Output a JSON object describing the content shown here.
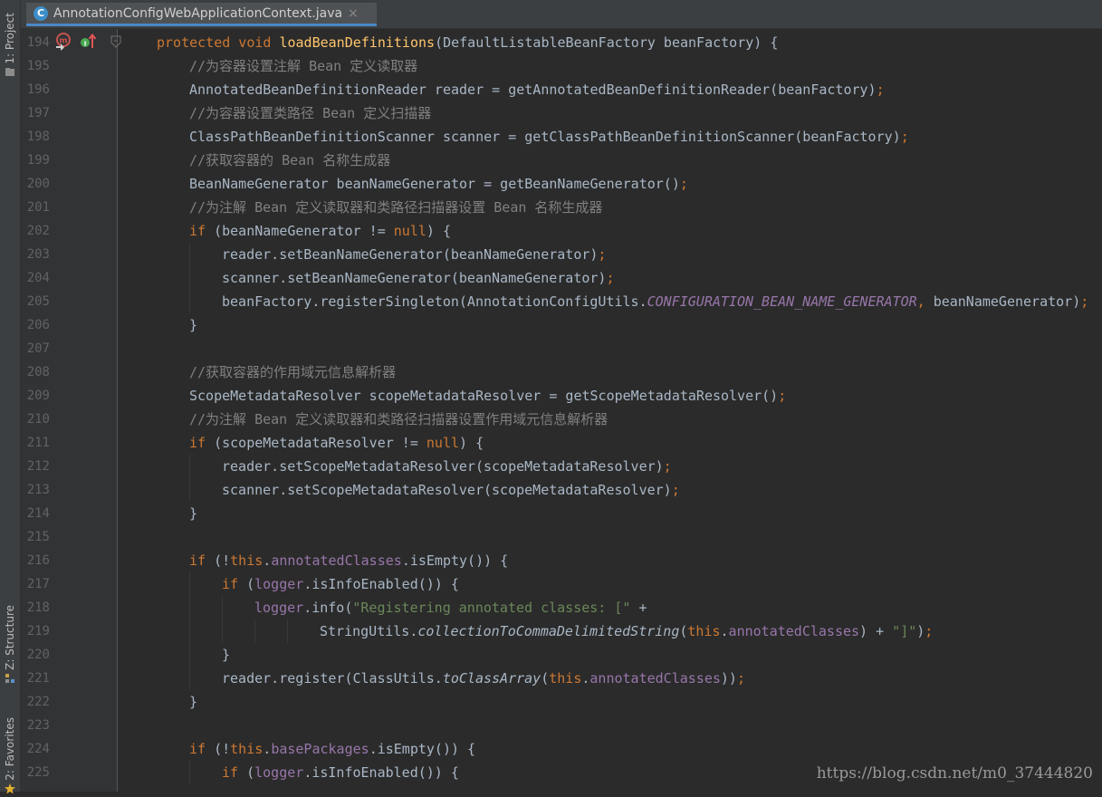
{
  "tab": {
    "icon_letter": "C",
    "filename": "AnnotationConfigWebApplicationContext.java",
    "close": "×"
  },
  "left_panels": [
    {
      "label": "1: Project",
      "icon": "project-icon"
    },
    {
      "label": "Z: Structure",
      "icon": "structure-icon"
    },
    {
      "label": "2: Favorites",
      "icon": "favorites-icon"
    }
  ],
  "gutter_markers": [
    "breakpoint-m-icon",
    "implements-override-icon",
    "fold-icon"
  ],
  "watermark": "https://blog.csdn.net/m0_37444820",
  "lines": [
    {
      "num": "194",
      "indent": 0,
      "tokens": [
        [
          "kw",
          "protected void "
        ],
        [
          "fn",
          "loadBeanDefinitions"
        ],
        [
          "txt",
          "(DefaultListableBeanFactory beanFactory) {"
        ]
      ]
    },
    {
      "num": "195",
      "indent": 1,
      "tokens": [
        [
          "cm",
          "//为容器设置注解 Bean 定义读取器"
        ]
      ]
    },
    {
      "num": "196",
      "indent": 1,
      "tokens": [
        [
          "txt",
          "AnnotatedBeanDefinitionReader reader = getAnnotatedBeanDefinitionReader(beanFactory)"
        ],
        [
          "kw",
          ";"
        ]
      ]
    },
    {
      "num": "197",
      "indent": 1,
      "tokens": [
        [
          "cm",
          "//为容器设置类路径 Bean 定义扫描器"
        ]
      ]
    },
    {
      "num": "198",
      "indent": 1,
      "tokens": [
        [
          "txt",
          "ClassPathBeanDefinitionScanner scanner = getClassPathBeanDefinitionScanner(beanFactory)"
        ],
        [
          "kw",
          ";"
        ]
      ]
    },
    {
      "num": "199",
      "indent": 1,
      "tokens": [
        [
          "cm",
          "//获取容器的 Bean 名称生成器"
        ]
      ]
    },
    {
      "num": "200",
      "indent": 1,
      "tokens": [
        [
          "txt",
          "BeanNameGenerator beanNameGenerator = getBeanNameGenerator()"
        ],
        [
          "kw",
          ";"
        ]
      ]
    },
    {
      "num": "201",
      "indent": 1,
      "tokens": [
        [
          "cm",
          "//为注解 Bean 定义读取器和类路径扫描器设置 Bean 名称生成器"
        ]
      ]
    },
    {
      "num": "202",
      "indent": 1,
      "tokens": [
        [
          "kw",
          "if "
        ],
        [
          "txt",
          "(beanNameGenerator != "
        ],
        [
          "kw",
          "null"
        ],
        [
          "txt",
          ") {"
        ]
      ]
    },
    {
      "num": "203",
      "indent": 2,
      "tokens": [
        [
          "txt",
          "reader.setBeanNameGenerator(beanNameGenerator)"
        ],
        [
          "kw",
          ";"
        ]
      ]
    },
    {
      "num": "204",
      "indent": 2,
      "tokens": [
        [
          "txt",
          "scanner.setBeanNameGenerator(beanNameGenerator)"
        ],
        [
          "kw",
          ";"
        ]
      ]
    },
    {
      "num": "205",
      "indent": 2,
      "tokens": [
        [
          "txt",
          "beanFactory.registerSingleton(AnnotationConfigUtils."
        ],
        [
          "fld it",
          "CONFIGURATION_BEAN_NAME_GENERATOR"
        ],
        [
          "kw",
          ", "
        ],
        [
          "txt",
          "beanNameGenerator)"
        ],
        [
          "kw",
          ";"
        ]
      ]
    },
    {
      "num": "206",
      "indent": 1,
      "tokens": [
        [
          "txt",
          "}"
        ]
      ]
    },
    {
      "num": "207",
      "indent": 1,
      "tokens": []
    },
    {
      "num": "208",
      "indent": 1,
      "tokens": [
        [
          "cm",
          "//获取容器的作用域元信息解析器"
        ]
      ]
    },
    {
      "num": "209",
      "indent": 1,
      "tokens": [
        [
          "txt",
          "ScopeMetadataResolver scopeMetadataResolver = getScopeMetadataResolver()"
        ],
        [
          "kw",
          ";"
        ]
      ]
    },
    {
      "num": "210",
      "indent": 1,
      "tokens": [
        [
          "cm",
          "//为注解 Bean 定义读取器和类路径扫描器设置作用域元信息解析器"
        ]
      ]
    },
    {
      "num": "211",
      "indent": 1,
      "tokens": [
        [
          "kw",
          "if "
        ],
        [
          "txt",
          "(scopeMetadataResolver != "
        ],
        [
          "kw",
          "null"
        ],
        [
          "txt",
          ") {"
        ]
      ]
    },
    {
      "num": "212",
      "indent": 2,
      "tokens": [
        [
          "txt",
          "reader.setScopeMetadataResolver(scopeMetadataResolver)"
        ],
        [
          "kw",
          ";"
        ]
      ]
    },
    {
      "num": "213",
      "indent": 2,
      "tokens": [
        [
          "txt",
          "scanner.setScopeMetadataResolver(scopeMetadataResolver)"
        ],
        [
          "kw",
          ";"
        ]
      ]
    },
    {
      "num": "214",
      "indent": 1,
      "tokens": [
        [
          "txt",
          "}"
        ]
      ]
    },
    {
      "num": "215",
      "indent": 1,
      "tokens": []
    },
    {
      "num": "216",
      "indent": 1,
      "tokens": [
        [
          "kw",
          "if "
        ],
        [
          "txt",
          "(!"
        ],
        [
          "kw",
          "this"
        ],
        [
          "txt",
          "."
        ],
        [
          "fld",
          "annotatedClasses"
        ],
        [
          "txt",
          ".isEmpty()) {"
        ]
      ]
    },
    {
      "num": "217",
      "indent": 2,
      "tokens": [
        [
          "kw",
          "if "
        ],
        [
          "txt",
          "("
        ],
        [
          "fld",
          "logger"
        ],
        [
          "txt",
          ".isInfoEnabled()) {"
        ]
      ]
    },
    {
      "num": "218",
      "indent": 3,
      "tokens": [
        [
          "fld",
          "logger"
        ],
        [
          "txt",
          ".info("
        ],
        [
          "str",
          "\"Registering annotated classes: [\""
        ],
        [
          "txt",
          " +"
        ]
      ]
    },
    {
      "num": "219",
      "indent": 5,
      "tokens": [
        [
          "txt",
          "StringUtils."
        ],
        [
          "txt it",
          "collectionToCommaDelimitedString"
        ],
        [
          "txt",
          "("
        ],
        [
          "kw",
          "this"
        ],
        [
          "txt",
          "."
        ],
        [
          "fld",
          "annotatedClasses"
        ],
        [
          "txt",
          ") + "
        ],
        [
          "str",
          "\"]\""
        ],
        [
          "txt",
          ")"
        ],
        [
          "kw",
          ";"
        ]
      ]
    },
    {
      "num": "220",
      "indent": 2,
      "tokens": [
        [
          "txt",
          "}"
        ]
      ]
    },
    {
      "num": "221",
      "indent": 2,
      "tokens": [
        [
          "txt",
          "reader.register(ClassUtils."
        ],
        [
          "txt it",
          "toClassArray"
        ],
        [
          "txt",
          "("
        ],
        [
          "kw",
          "this"
        ],
        [
          "txt",
          "."
        ],
        [
          "fld",
          "annotatedClasses"
        ],
        [
          "txt",
          "))"
        ],
        [
          "kw",
          ";"
        ]
      ]
    },
    {
      "num": "222",
      "indent": 1,
      "tokens": [
        [
          "txt",
          "}"
        ]
      ]
    },
    {
      "num": "223",
      "indent": 1,
      "tokens": []
    },
    {
      "num": "224",
      "indent": 1,
      "tokens": [
        [
          "kw",
          "if "
        ],
        [
          "txt",
          "(!"
        ],
        [
          "kw",
          "this"
        ],
        [
          "txt",
          "."
        ],
        [
          "fld",
          "basePackages"
        ],
        [
          "txt",
          ".isEmpty()) {"
        ]
      ]
    },
    {
      "num": "225",
      "indent": 2,
      "tokens": [
        [
          "kw",
          "if "
        ],
        [
          "txt",
          "("
        ],
        [
          "fld",
          "logger"
        ],
        [
          "txt",
          ".isInfoEnabled()) {"
        ]
      ]
    }
  ]
}
